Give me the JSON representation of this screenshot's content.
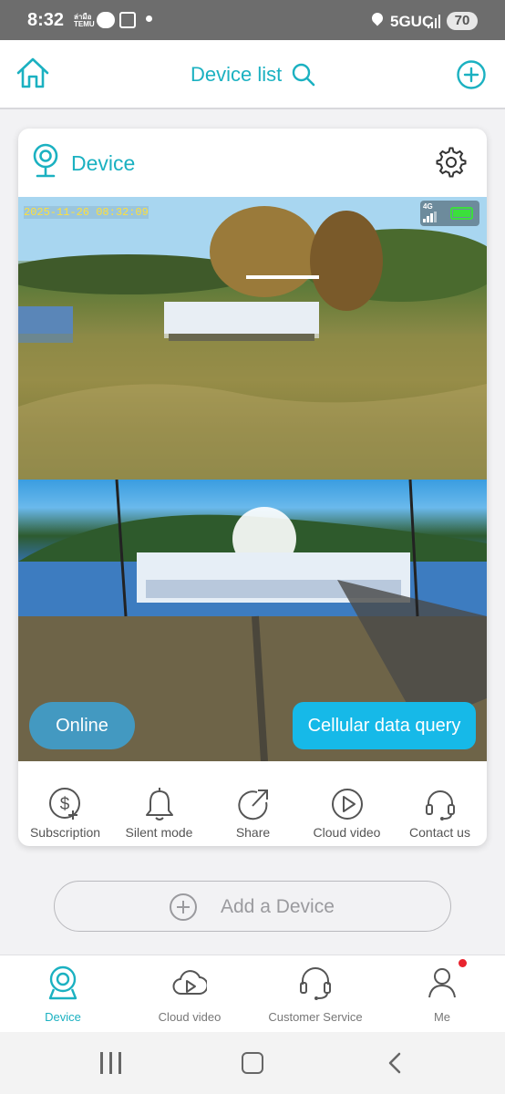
{
  "status_bar": {
    "time": "8:32",
    "temu": "ล่ามือ TEMU",
    "network": "5GUC",
    "battery": "70"
  },
  "header": {
    "title": "Device list"
  },
  "device_card": {
    "title": "Device",
    "camera": {
      "timestamp": "2025-11-26 08:32:09",
      "network_badge": "4G"
    },
    "online_label": "Online",
    "cellular_button_label": "Cellular data query",
    "actions": [
      {
        "label": "Subscription",
        "icon": "subscription-icon"
      },
      {
        "label": "Silent mode",
        "icon": "bell-icon"
      },
      {
        "label": "Share",
        "icon": "share-icon"
      },
      {
        "label": "Cloud video",
        "icon": "play-icon"
      },
      {
        "label": "Contact us",
        "icon": "headset-icon"
      }
    ]
  },
  "add_device": {
    "label": "Add a Device"
  },
  "bottom_nav": [
    {
      "label": "Device",
      "icon": "camera-icon",
      "active": true
    },
    {
      "label": "Cloud video",
      "icon": "cloud-play-icon",
      "active": false
    },
    {
      "label": "Customer Service",
      "icon": "headset-icon",
      "active": false
    },
    {
      "label": "Me",
      "icon": "person-icon",
      "active": false
    }
  ],
  "colors": {
    "accent": "#1bb1c1",
    "cellular_button": "#16b9e8",
    "notification_dot": "#e8232e"
  }
}
